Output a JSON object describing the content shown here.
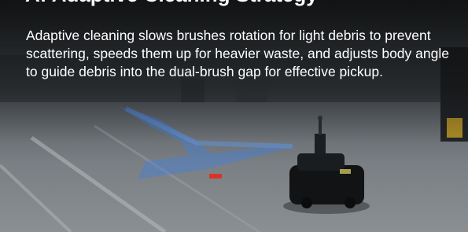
{
  "card": {
    "title": "A: Adaptive Cleaning Strategy",
    "description": "Adaptive cleaning slows brushes rotation for light debris to prevent scattering, speeds them up for heavier waste, and adjusts body angle to guide debris into the dual-brush gap for effective pickup."
  },
  "colors": {
    "path_highlight": "#3f7fe0",
    "debris_marker": "#d9342b",
    "robot_body": "#111315"
  },
  "icons": {
    "robot": "cleaning-robot-image",
    "path": "blue-guidance-path"
  }
}
